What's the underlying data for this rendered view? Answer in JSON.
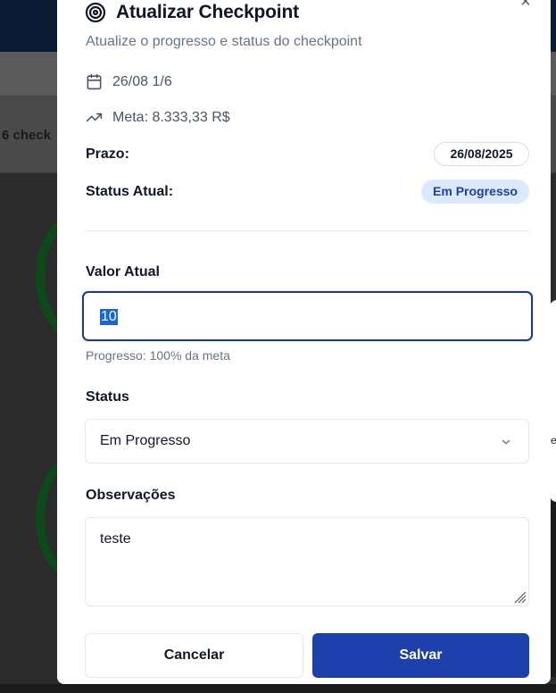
{
  "background": {
    "row_text": "6 check",
    "side_letter": "e"
  },
  "modal": {
    "close_glyph": "×",
    "title": "Atualizar Checkpoint",
    "title_icon": "target-icon",
    "subtitle": "Atualize o progresso e status do checkpoint",
    "checkpoint_name": "26/08 1/6",
    "goal_text": "Meta: 8.333,33 R$",
    "deadline_label": "Prazo:",
    "deadline_value": "26/08/2025",
    "current_status_label": "Status Atual:",
    "current_status_value": "Em Progresso",
    "current_value_label": "Valor Atual",
    "current_value": "10",
    "progress_hint": "Progresso: 100% da meta",
    "status_label": "Status",
    "status_selected": "Em Progresso",
    "notes_label": "Observações",
    "notes_value": "teste",
    "cancel_label": "Cancelar",
    "save_label": "Salvar"
  },
  "colors": {
    "primary": "#1e40af",
    "status_badge_bg": "#dbe9fe",
    "title": "#0f1729",
    "muted": "#64748b"
  }
}
